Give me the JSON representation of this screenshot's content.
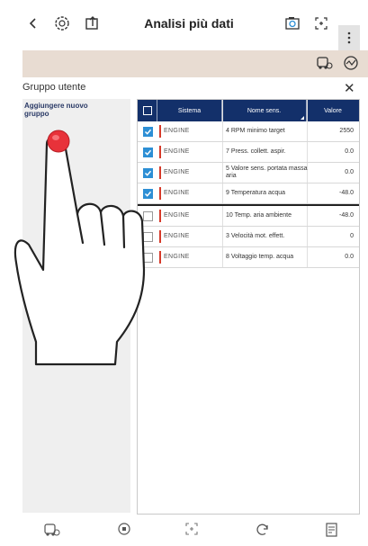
{
  "header": {
    "back_icon": "chevron-left-icon",
    "title": "Analisi più dati",
    "icons": [
      "vehicle-settings-icon",
      "export-icon",
      "camera-icon",
      "fullscreen-icon",
      "more-vertical-icon"
    ]
  },
  "subbar": {
    "icons": [
      "vehicle-icon",
      "gauge-icon"
    ]
  },
  "group": {
    "title": "Gruppo utente",
    "add_label": "Aggiungere nuovo\ngruppo"
  },
  "table": {
    "headers": [
      "Sistema",
      "Nome sens.",
      "Valore"
    ],
    "rows": [
      {
        "checked": true,
        "system": "ENGINE",
        "name": "4 RPM minimo target",
        "value": "2550"
      },
      {
        "checked": true,
        "system": "ENGINE",
        "name": "7 Press. collett. aspir.",
        "value": "0.0"
      },
      {
        "checked": true,
        "system": "ENGINE",
        "name": "5 Valore sens. portata massa aria",
        "value": "0.0"
      },
      {
        "checked": true,
        "system": "ENGINE",
        "name": "9 Temperatura acqua",
        "value": "-48.0"
      },
      {
        "checked": false,
        "system": "ENGINE",
        "name": "10 Temp. aria ambiente",
        "value": "-48.0"
      },
      {
        "checked": false,
        "system": "ENGINE",
        "name": "3 Velocità mot. effett.",
        "value": "0"
      },
      {
        "checked": false,
        "system": "ENGINE",
        "name": "8 Voltaggio temp. acqua",
        "value": "0.0"
      }
    ]
  },
  "bottom_bar": {
    "icons": [
      "vehicle-icon",
      "record-icon",
      "screenshot-icon",
      "refresh-icon",
      "report-icon"
    ]
  },
  "colors": {
    "header_bg": "#13306a",
    "checkbox_on": "#2d8fd5",
    "system_bar": "#d63a2a",
    "subbar_bg": "#e8dcd2",
    "touch_dot": "#e8323a"
  }
}
